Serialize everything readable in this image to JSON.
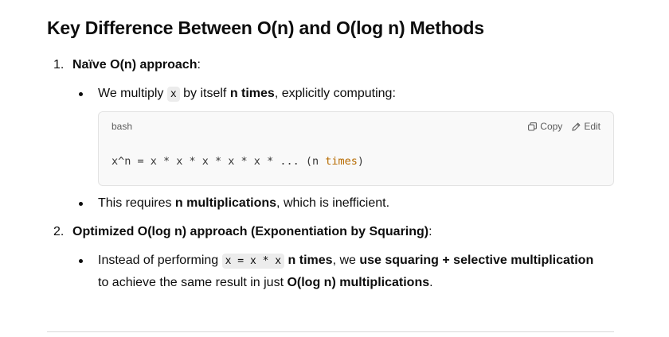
{
  "heading": "Key Difference Between O(n) and O(log n) Methods",
  "items": [
    {
      "number": "1.",
      "title": "Naïve O(n) approach",
      "title_suffix": ":",
      "bullets": [
        {
          "pre": "We multiply ",
          "code": "x",
          "mid": " by itself ",
          "bold": "n times",
          "post": ", explicitly computing:"
        },
        {
          "pre": "This requires ",
          "bold": "n multiplications",
          "post": ", which is inefficient."
        }
      ],
      "codeblock": {
        "language": "bash",
        "copy_label": "Copy",
        "edit_label": "Edit",
        "code_main": "x^n = x * x * x * x * x * ... (n ",
        "code_keyword": "times",
        "code_end": ")"
      }
    },
    {
      "number": "2.",
      "title": "Optimized O(log n) approach (Exponentiation by Squaring)",
      "title_suffix": ":",
      "bullets": [
        {
          "pre": "Instead of performing ",
          "code": "x = x * x",
          "mid_bold": " n times",
          "mid": ", we ",
          "bold": "use squaring + selective multiplication",
          "line2_pre": "to achieve the same result in just ",
          "line2_bold": "O(log n) multiplications",
          "line2_post": "."
        }
      ]
    }
  ]
}
